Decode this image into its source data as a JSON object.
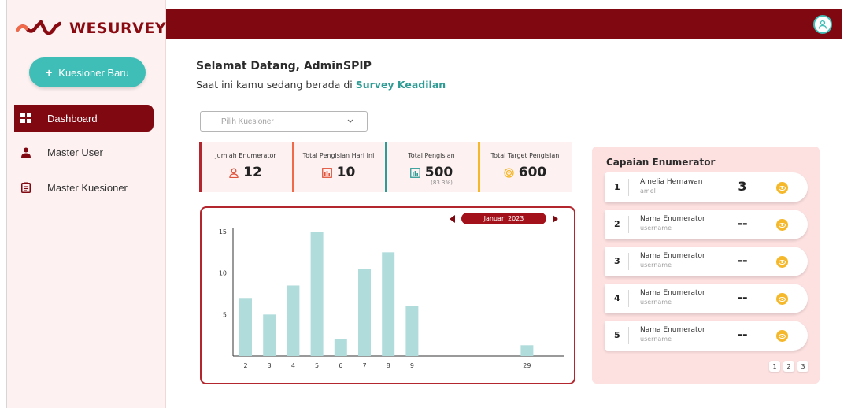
{
  "brand": {
    "name": "WESURVEY",
    "accent": "#7f0811",
    "teal": "#3ebeb6"
  },
  "sidebar": {
    "new_button": "Kuesioner Baru",
    "items": [
      {
        "label": "Dashboard",
        "icon": "dashboard-icon",
        "active": true
      },
      {
        "label": "Master User",
        "icon": "user-icon",
        "active": false
      },
      {
        "label": "Master Kuesioner",
        "icon": "clipboard-icon",
        "active": false
      }
    ]
  },
  "header": {
    "avatar_icon": "user-circle-icon"
  },
  "greeting": {
    "title": "Selamat Datang, AdminSPIP",
    "subtitle_prefix": "Saat ini kamu sedang berada di",
    "survey_name": "Survey Keadilan"
  },
  "filter": {
    "placeholder": "Pilih Kuesioner"
  },
  "stats": [
    {
      "label": "Jumlah Enumerator",
      "value": "12",
      "icon": "user-icon",
      "color": "#b3262e"
    },
    {
      "label": "Total Pengisian Hari Ini",
      "value": "10",
      "icon": "calendar-chart-icon",
      "color": "#f06a4a"
    },
    {
      "label": "Total Pengisian",
      "value": "500",
      "note": "(83.3%)",
      "icon": "bar-chart-icon",
      "color": "#2e9c95"
    },
    {
      "label": "Total Target Pengisian",
      "value": "600",
      "icon": "target-icon",
      "color": "#f5b82a"
    }
  ],
  "chart_month": "Januari 2023",
  "chart_data": {
    "type": "bar",
    "categories": [
      "2",
      "3",
      "4",
      "5",
      "6",
      "7",
      "8",
      "9",
      "29"
    ],
    "values": [
      7,
      5,
      8.5,
      15,
      2,
      10.5,
      12.5,
      6,
      1.3
    ],
    "title": "",
    "xlabel": "",
    "ylabel": "",
    "ylim": [
      0,
      15
    ],
    "yticks": [
      5,
      10,
      15
    ],
    "bar_color": "#b1dcdc",
    "grid": false
  },
  "capaian": {
    "title": "Capaian Enumerator",
    "rows": [
      {
        "rank": "1",
        "name": "Amelia Hernawan",
        "username": "amel",
        "score": "3"
      },
      {
        "rank": "2",
        "name": "Nama Enumerator",
        "username": "username",
        "score": "--"
      },
      {
        "rank": "3",
        "name": "Nama Enumerator",
        "username": "username",
        "score": "--"
      },
      {
        "rank": "4",
        "name": "Nama Enumerator",
        "username": "username",
        "score": "--"
      },
      {
        "rank": "5",
        "name": "Nama Enumerator",
        "username": "username",
        "score": "--"
      }
    ],
    "pages": [
      "1",
      "2",
      "3"
    ]
  }
}
